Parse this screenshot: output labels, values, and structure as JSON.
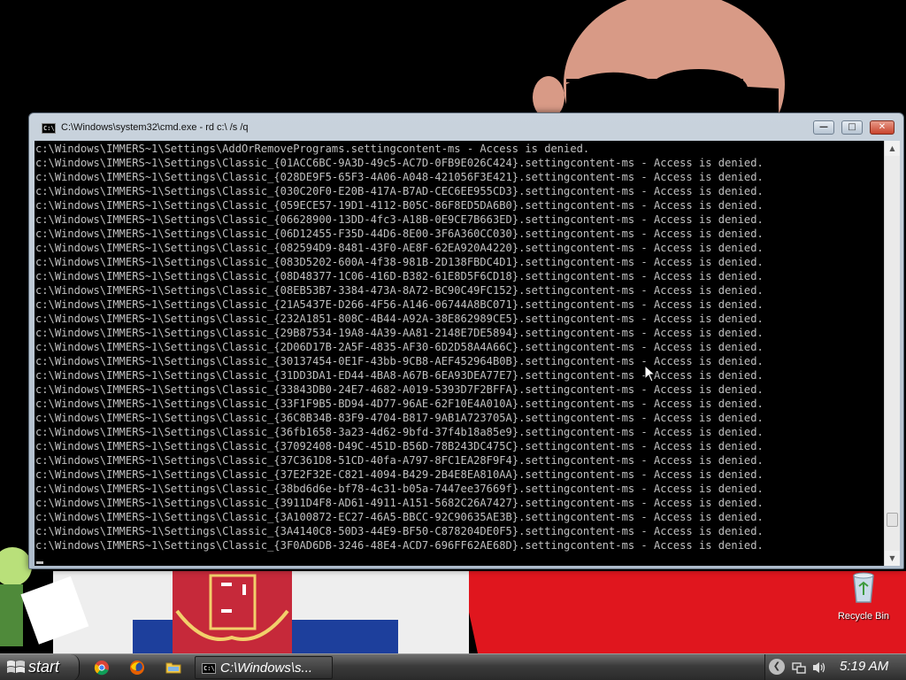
{
  "window": {
    "title": "C:\\Windows\\system32\\cmd.exe - rd  c:\\ /s /q",
    "icon_text": "C:\\"
  },
  "console_lines": [
    "c:\\Windows\\IMMERS~1\\Settings\\AddOrRemovePrograms.settingcontent-ms - Access is denied.",
    "c:\\Windows\\IMMERS~1\\Settings\\Classic_{01ACC6BC-9A3D-49c5-AC7D-0FB9E026C424}.settingcontent-ms - Access is denied.",
    "c:\\Windows\\IMMERS~1\\Settings\\Classic_{028DE9F5-65F3-4A06-A048-421056F3E421}.settingcontent-ms - Access is denied.",
    "c:\\Windows\\IMMERS~1\\Settings\\Classic_{030C20F0-E20B-417A-B7AD-CEC6EE955CD3}.settingcontent-ms - Access is denied.",
    "c:\\Windows\\IMMERS~1\\Settings\\Classic_{059ECE57-19D1-4112-B05C-86F8ED5DA6B0}.settingcontent-ms - Access is denied.",
    "c:\\Windows\\IMMERS~1\\Settings\\Classic_{06628900-13DD-4fc3-A18B-0E9CE7B663ED}.settingcontent-ms - Access is denied.",
    "c:\\Windows\\IMMERS~1\\Settings\\Classic_{06D12455-F35D-44D6-8E00-3F6A360CC030}.settingcontent-ms - Access is denied.",
    "c:\\Windows\\IMMERS~1\\Settings\\Classic_{082594D9-8481-43F0-AE8F-62EA920A4220}.settingcontent-ms - Access is denied.",
    "c:\\Windows\\IMMERS~1\\Settings\\Classic_{083D5202-600A-4f38-981B-2D138FBDC4D1}.settingcontent-ms - Access is denied.",
    "c:\\Windows\\IMMERS~1\\Settings\\Classic_{08D48377-1C06-416D-B382-61E8D5F6CD18}.settingcontent-ms - Access is denied.",
    "c:\\Windows\\IMMERS~1\\Settings\\Classic_{08EB53B7-3384-473A-8A72-BC90C49FC152}.settingcontent-ms - Access is denied.",
    "c:\\Windows\\IMMERS~1\\Settings\\Classic_{21A5437E-D266-4F56-A146-06744A8BC071}.settingcontent-ms - Access is denied.",
    "c:\\Windows\\IMMERS~1\\Settings\\Classic_{232A1851-808C-4B44-A92A-38E862989CE5}.settingcontent-ms - Access is denied.",
    "c:\\Windows\\IMMERS~1\\Settings\\Classic_{29B87534-19A8-4A39-AA81-2148E7DE5894}.settingcontent-ms - Access is denied.",
    "c:\\Windows\\IMMERS~1\\Settings\\Classic_{2D06D17B-2A5F-4835-AF30-6D2D58A4A66C}.settingcontent-ms - Access is denied.",
    "c:\\Windows\\IMMERS~1\\Settings\\Classic_{30137454-0E1F-43bb-9CB8-AEF452964B0B}.settingcontent-ms - Access is denied.",
    "c:\\Windows\\IMMERS~1\\Settings\\Classic_{31DD3DA1-ED44-4BA8-A67B-6EA93DEA77E7}.settingcontent-ms - Access is denied.",
    "c:\\Windows\\IMMERS~1\\Settings\\Classic_{33843DB0-24E7-4682-A019-5393D7F2BFFA}.settingcontent-ms - Access is denied.",
    "c:\\Windows\\IMMERS~1\\Settings\\Classic_{33F1F9B5-BD94-4D77-96AE-62F10E4A010A}.settingcontent-ms - Access is denied.",
    "c:\\Windows\\IMMERS~1\\Settings\\Classic_{36C8B34B-83F9-4704-B817-9AB1A723705A}.settingcontent-ms - Access is denied.",
    "c:\\Windows\\IMMERS~1\\Settings\\Classic_{36fb1658-3a23-4d62-9bfd-37f4b18a85e9}.settingcontent-ms - Access is denied.",
    "c:\\Windows\\IMMERS~1\\Settings\\Classic_{37092408-D49C-451D-B56D-78B243DC475C}.settingcontent-ms - Access is denied.",
    "c:\\Windows\\IMMERS~1\\Settings\\Classic_{37C361D8-51CD-40fa-A797-8FC1EA28F9F4}.settingcontent-ms - Access is denied.",
    "c:\\Windows\\IMMERS~1\\Settings\\Classic_{37E2F32E-C821-4094-B429-2B4E8EA810AA}.settingcontent-ms - Access is denied.",
    "c:\\Windows\\IMMERS~1\\Settings\\Classic_{38bd6d6e-bf78-4c31-b05a-7447ee37669f}.settingcontent-ms - Access is denied.",
    "c:\\Windows\\IMMERS~1\\Settings\\Classic_{3911D4F8-AD61-4911-A151-5682C26A7427}.settingcontent-ms - Access is denied.",
    "c:\\Windows\\IMMERS~1\\Settings\\Classic_{3A100872-EC27-46A5-BBCC-92C90635AE3B}.settingcontent-ms - Access is denied.",
    "c:\\Windows\\IMMERS~1\\Settings\\Classic_{3A4140C8-50D3-44E9-BF50-C878204DE0F5}.settingcontent-ms - Access is denied.",
    "c:\\Windows\\IMMERS~1\\Settings\\Classic_{3F0AD6DB-3246-48E4-ACD7-696FF62AE68D}.settingcontent-ms - Access is denied."
  ],
  "desktop": {
    "recycle_bin_label": "Recycle Bin"
  },
  "taskbar": {
    "start_label": "start",
    "active_task_label": "C:\\Windows\\s...",
    "clock": "5:19 AM"
  },
  "icons": {
    "quick_launch": [
      "chrome-icon",
      "firefox-icon",
      "folder-icon"
    ],
    "tray": [
      "chevron-left-icon",
      "network-icon",
      "volume-icon"
    ]
  },
  "colors": {
    "console_bg": "#000000",
    "console_text": "#c0c0c0",
    "close_button": "#c8432c",
    "taskbar": "#2a2a2a"
  }
}
